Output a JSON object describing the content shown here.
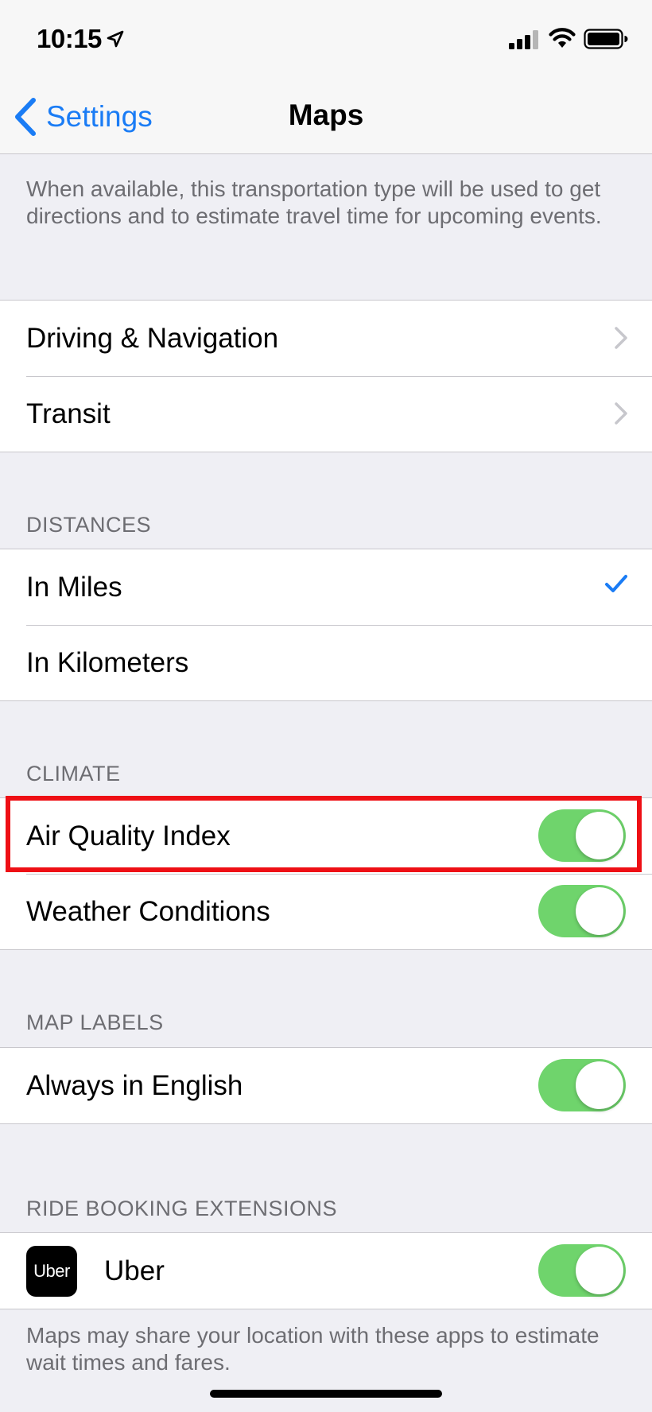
{
  "status_bar": {
    "time": "10:15"
  },
  "nav": {
    "back_label": "Settings",
    "title": "Maps"
  },
  "transport_footer": "When available, this transportation type will be used to get directions and to estimate travel time for upcoming events.",
  "nav_group": {
    "items": [
      {
        "label": "Driving & Navigation"
      },
      {
        "label": "Transit"
      }
    ]
  },
  "distances": {
    "header": "DISTANCES",
    "items": [
      {
        "label": "In Miles",
        "selected": true
      },
      {
        "label": "In Kilometers",
        "selected": false
      }
    ]
  },
  "climate": {
    "header": "CLIMATE",
    "items": [
      {
        "label": "Air Quality Index",
        "on": true
      },
      {
        "label": "Weather Conditions",
        "on": true
      }
    ]
  },
  "map_labels": {
    "header": "MAP LABELS",
    "items": [
      {
        "label": "Always in English",
        "on": true
      }
    ]
  },
  "ride_booking": {
    "header": "RIDE BOOKING EXTENSIONS",
    "items": [
      {
        "label": "Uber",
        "logo_text": "Uber",
        "on": true
      }
    ]
  },
  "ride_footer": "Maps may share your location with these apps to estimate wait times and fares.",
  "colors": {
    "accent": "#1a7cf5",
    "toggle_on": "#6fd46c",
    "highlight": "#ee0f15",
    "background": "#efeff4"
  }
}
